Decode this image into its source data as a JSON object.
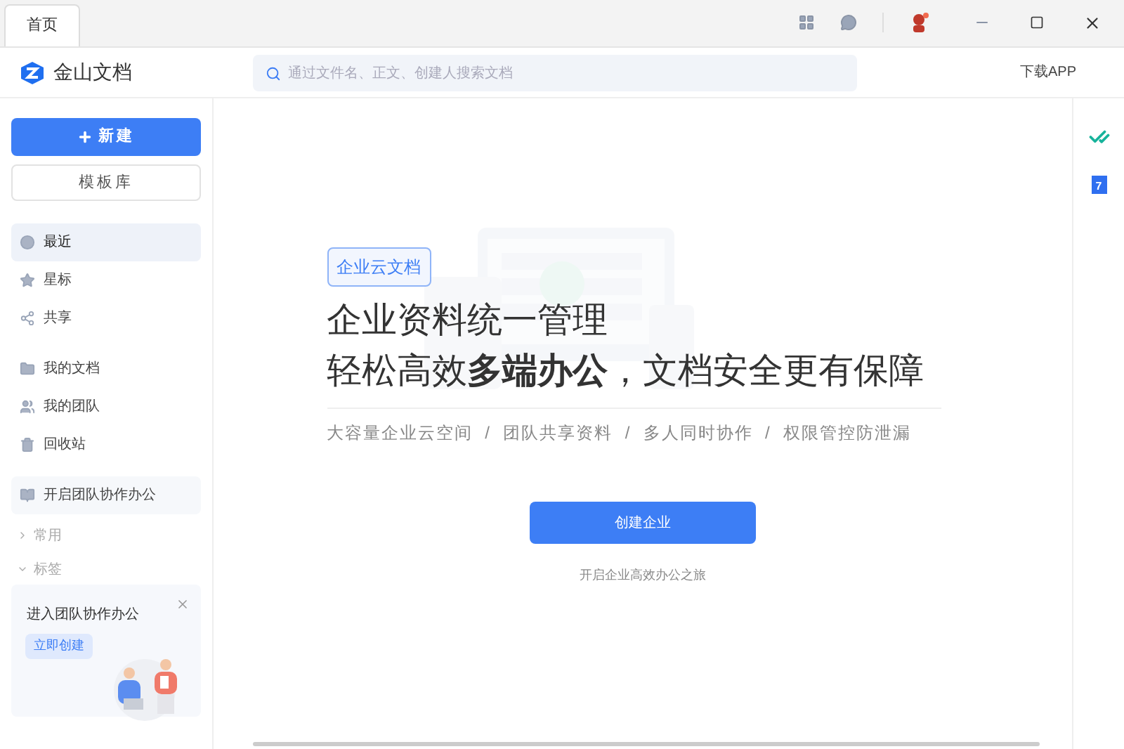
{
  "tabs": [
    {
      "label": "首页",
      "selected": true
    }
  ],
  "header": {
    "app_name": "金山文档",
    "search": {
      "placeholder": "通过文件名、正文、创建人搜索文档"
    },
    "download": "下载APP"
  },
  "sidebar": {
    "new_button": "新建",
    "template_button": "模板库",
    "items": [
      {
        "label": "最近",
        "selected": true
      },
      {
        "label": "星标",
        "selected": false
      },
      {
        "label": "共享",
        "selected": false
      },
      {
        "label": "我的文档",
        "selected": false
      },
      {
        "label": "我的团队",
        "selected": false
      },
      {
        "label": "回收站",
        "selected": false
      },
      {
        "label": "开启团队协作办公",
        "selected": false
      }
    ],
    "sections": [
      {
        "label": "常用",
        "expanded": false
      },
      {
        "label": "标签",
        "expanded": true
      }
    ],
    "promo": {
      "title": "进入团队协作办公",
      "button": "立即创建"
    }
  },
  "main": {
    "badge": "企业云文档",
    "headline": [
      "企业资料统一管理",
      "轻松高效**多端办公**，文档安全更有保障"
    ],
    "features": "大容量企业云空间  /  团队共享资料  /  多人同时协作  /  权限管控防泄漏",
    "button": "创建企业",
    "link": "开启企业高效办公之旅"
  },
  "right_rail": {
    "calendar_day": "7"
  }
}
